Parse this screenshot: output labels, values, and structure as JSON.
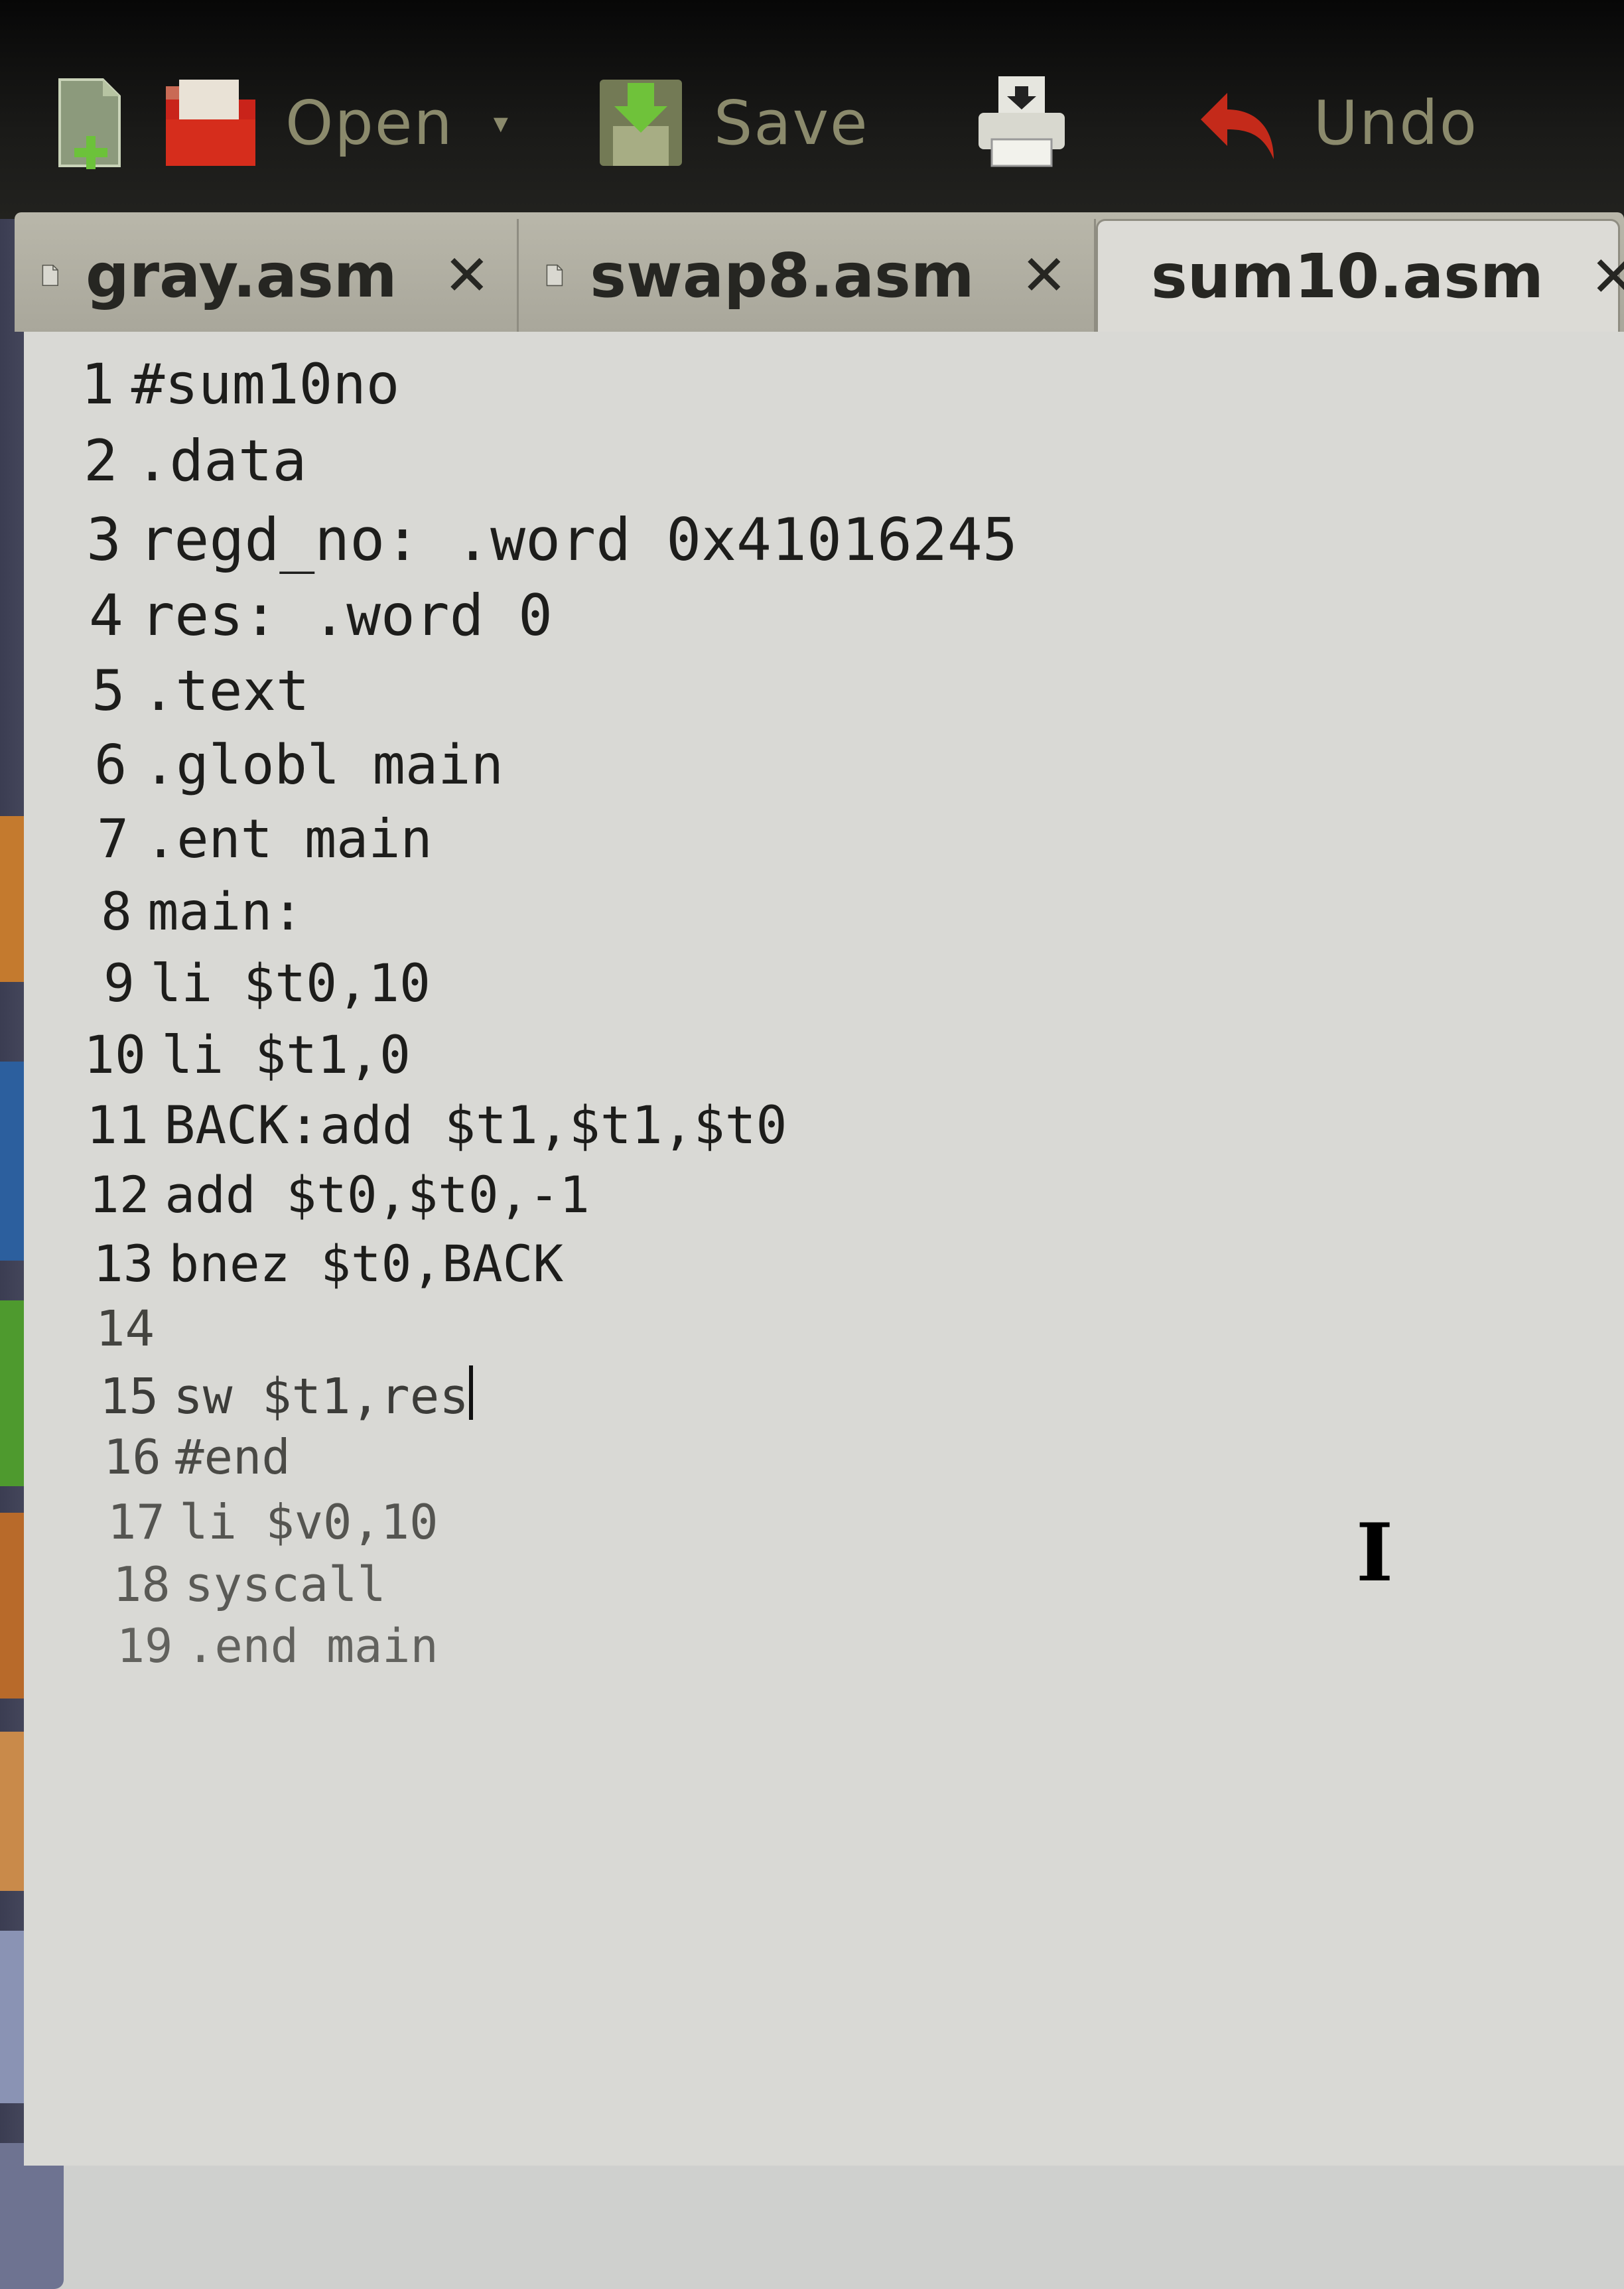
{
  "toolbar": {
    "buttons": [
      {
        "name": "new",
        "label": "",
        "icon": "new-document-icon"
      },
      {
        "name": "open",
        "label": "Open",
        "icon": "open-folder-icon"
      },
      {
        "name": "save",
        "label": "Save",
        "icon": "save-icon"
      },
      {
        "name": "print",
        "label": "",
        "icon": "print-icon"
      },
      {
        "name": "undo",
        "label": "Undo",
        "icon": "undo-arrow-icon"
      }
    ],
    "open_label": "Open",
    "open_dropdown": "▾",
    "save_label": "Save",
    "undo_label": "Undo"
  },
  "tabs": [
    {
      "label": "gray.asm",
      "close": "✕"
    },
    {
      "label": "swap8.asm",
      "close": "✕"
    },
    {
      "label": "sum10.asm",
      "close": "✕",
      "active": true
    }
  ],
  "editor": {
    "lines": [
      {
        "num": "1",
        "text": "#sum10no"
      },
      {
        "num": "2",
        "text": ".data"
      },
      {
        "num": "3",
        "text": "regd_no: .word 0x41016245"
      },
      {
        "num": "4",
        "text": "res: .word 0"
      },
      {
        "num": "5",
        "text": ".text"
      },
      {
        "num": "6",
        "text": ".globl main"
      },
      {
        "num": "7",
        "text": ".ent main"
      },
      {
        "num": "8",
        "text": "main:"
      },
      {
        "num": "9",
        "text": "li $t0,10"
      },
      {
        "num": "10",
        "text": "li $t1,0"
      },
      {
        "num": "11",
        "text": "BACK:add $t1,$t1,$t0"
      },
      {
        "num": "12",
        "text": "add $t0,$t0,-1"
      },
      {
        "num": "13",
        "text": "bnez $t0,BACK"
      },
      {
        "num": "14",
        "text": ""
      },
      {
        "num": "15",
        "text": "sw $t1,res"
      },
      {
        "num": "16",
        "text": "#end"
      },
      {
        "num": "17",
        "text": "li $v0,10"
      },
      {
        "num": "18",
        "text": "syscall"
      },
      {
        "num": "19",
        "text": ".end main"
      }
    ],
    "cursor_line": "15",
    "mouse_cursor_icon": "text-ibeam-icon",
    "mouse_cursor_glyph": "I"
  }
}
